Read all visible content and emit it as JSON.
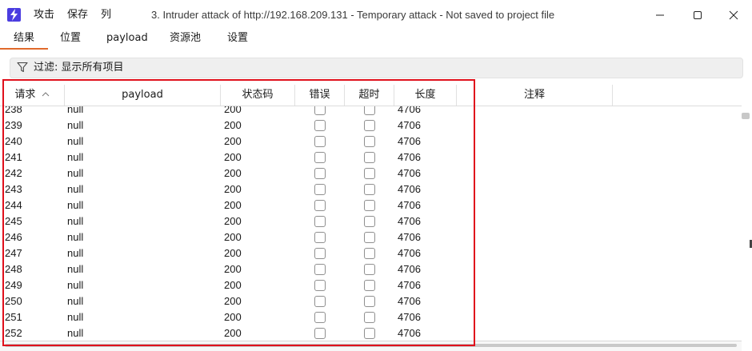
{
  "window": {
    "title": "3. Intruder attack of http://192.168.209.131 - Temporary attack - Not saved to project file",
    "menu": [
      "攻击",
      "保存",
      "列"
    ]
  },
  "tabs": [
    "结果",
    "位置",
    "payload",
    "资源池",
    "设置"
  ],
  "filter": {
    "label": "过滤: 显示所有项目"
  },
  "table": {
    "columns": [
      "请求",
      "payload",
      "状态码",
      "错误",
      "超时",
      "长度",
      "注释"
    ],
    "sort_indicator": "^",
    "rows": [
      {
        "req": "238",
        "payload": "null",
        "status": "200",
        "length": "4706"
      },
      {
        "req": "239",
        "payload": "null",
        "status": "200",
        "length": "4706"
      },
      {
        "req": "240",
        "payload": "null",
        "status": "200",
        "length": "4706"
      },
      {
        "req": "241",
        "payload": "null",
        "status": "200",
        "length": "4706"
      },
      {
        "req": "242",
        "payload": "null",
        "status": "200",
        "length": "4706"
      },
      {
        "req": "243",
        "payload": "null",
        "status": "200",
        "length": "4706"
      },
      {
        "req": "244",
        "payload": "null",
        "status": "200",
        "length": "4706"
      },
      {
        "req": "245",
        "payload": "null",
        "status": "200",
        "length": "4706"
      },
      {
        "req": "246",
        "payload": "null",
        "status": "200",
        "length": "4706"
      },
      {
        "req": "247",
        "payload": "null",
        "status": "200",
        "length": "4706"
      },
      {
        "req": "248",
        "payload": "null",
        "status": "200",
        "length": "4706"
      },
      {
        "req": "249",
        "payload": "null",
        "status": "200",
        "length": "4706"
      },
      {
        "req": "250",
        "payload": "null",
        "status": "200",
        "length": "4706"
      },
      {
        "req": "251",
        "payload": "null",
        "status": "200",
        "length": "4706"
      },
      {
        "req": "252",
        "payload": "null",
        "status": "200",
        "length": "4706"
      }
    ]
  },
  "colors": {
    "accent": "#e06a2b",
    "app_icon": "#4b3de0",
    "highlight": "#e0101c"
  }
}
